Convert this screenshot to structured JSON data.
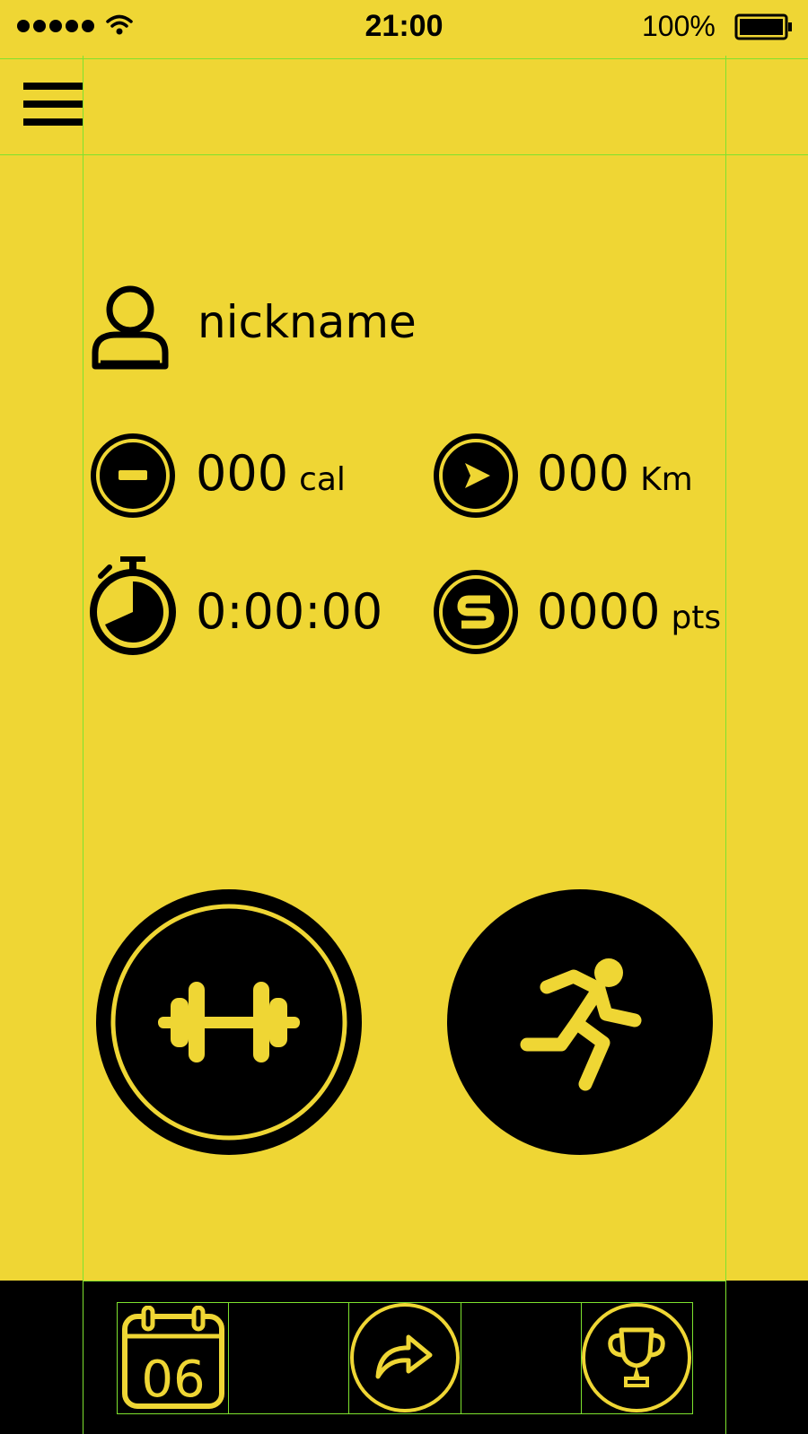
{
  "status_bar": {
    "time": "21:00",
    "battery_percent": "100%",
    "signal_dots": 5
  },
  "header": {
    "menu_icon": "hamburger-menu-icon"
  },
  "profile": {
    "nickname": "nickname",
    "icon": "user-icon"
  },
  "stats": {
    "calories": {
      "value": "000",
      "unit": "cal",
      "icon": "minus-circle-icon"
    },
    "distance": {
      "value": "000",
      "unit": "Km",
      "icon": "play-circle-icon"
    },
    "duration": {
      "value": "0:00:00",
      "icon": "stopwatch-icon"
    },
    "points": {
      "value": "0000",
      "unit": "pts",
      "icon": "s-coin-icon"
    }
  },
  "actions": {
    "workout": {
      "icon": "dumbbell-icon"
    },
    "run": {
      "icon": "running-person-icon"
    }
  },
  "tabbar": {
    "calendar_day": "06",
    "share_icon": "share-arrow-icon",
    "trophy_icon": "trophy-icon"
  },
  "colors": {
    "background": "#EFD634",
    "foreground": "#000000",
    "guide": "#7EE22E"
  }
}
